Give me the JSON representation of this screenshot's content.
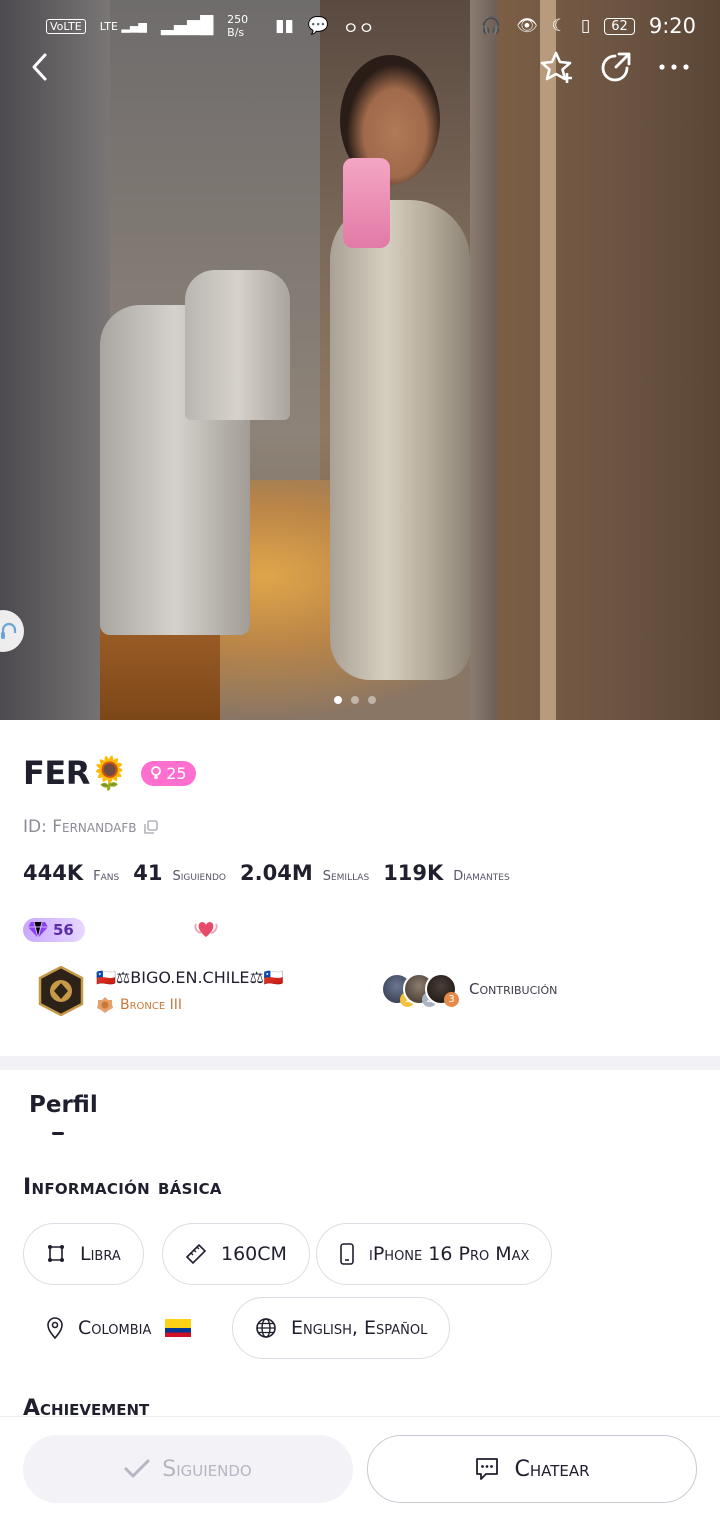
{
  "status_bar": {
    "left_badges": [
      "VoLTE",
      "LTE"
    ],
    "net_speed": "250 B/s",
    "battery": "62",
    "time": "9:20"
  },
  "top_bar": {
    "back_icon": "chevron-left-icon",
    "favorite_icon": "star-plus-icon",
    "share_icon": "share-icon",
    "more_icon": "more-icon"
  },
  "carousel": {
    "pages": 3,
    "active_index": 0
  },
  "profile": {
    "name": "FER🌻",
    "level": "25",
    "id_text": "ID: Fernandafb",
    "stats": [
      {
        "value": "444K",
        "label": "Fans"
      },
      {
        "value": "41",
        "label": "Siguiendo"
      },
      {
        "value": "2.04M",
        "label": "Semillas"
      },
      {
        "value": "119K",
        "label": "Diamantes"
      }
    ],
    "vip_level": "56",
    "family": {
      "name": "🇨🇱⚖BIGO.EN.CHILE⚖🇨🇱",
      "rank": "Bronce III"
    },
    "contributors": [
      "1",
      "2",
      "3"
    ],
    "contribution_label": "Contribución"
  },
  "details": {
    "tab_label": "Perfil",
    "section_title": "Información básica",
    "chips": {
      "sign": "Libra",
      "height": "160CM",
      "device": "iPhone 16 Pro Max",
      "country": "Colombia",
      "languages": "English, Español"
    },
    "achievement_title": "Achievement"
  },
  "bottom_bar": {
    "follow_label": "Siguiendo",
    "chat_label": "Chatear"
  },
  "colors": {
    "level_pill": "#ff6fcf",
    "vip": "#c9a8ff",
    "family_rank": "#c8793a",
    "follow_bg": "#f2f2f7"
  }
}
